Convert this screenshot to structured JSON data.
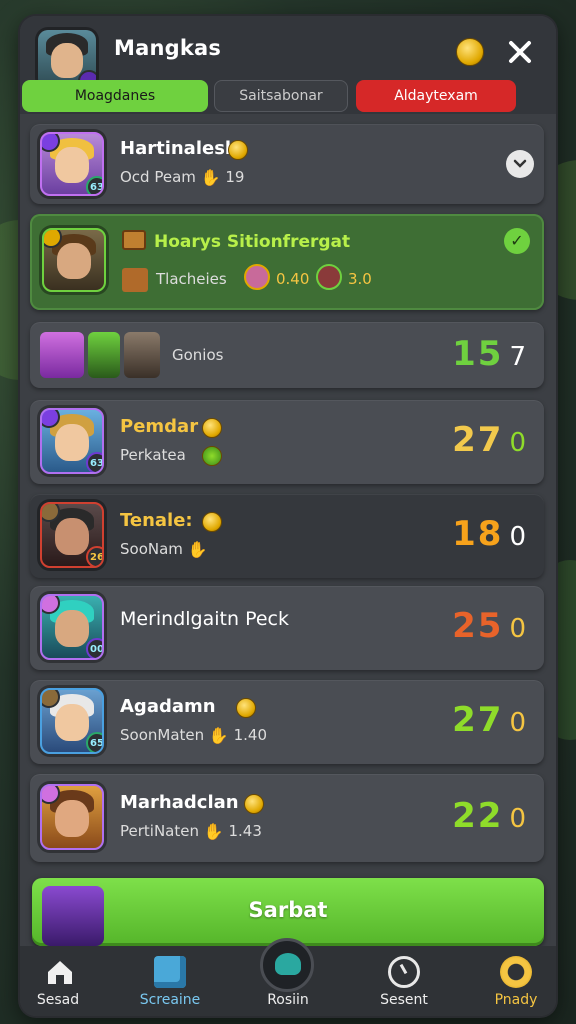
{
  "header": {
    "title": "Mangkas",
    "tabs": [
      {
        "label": "Moagdanes",
        "color": "#6fd13f"
      },
      {
        "label": "Saitsabonar",
        "color": "#3a3d42"
      },
      {
        "label": "Aldaytexam",
        "color": "#d62828"
      }
    ]
  },
  "featured": {
    "name": "Hartinalesk",
    "sub": "Ocd Peam",
    "count": "19",
    "badge": "63"
  },
  "highlight": {
    "title": "Hoarys Sitionfrergat",
    "sub": "Tlacheies",
    "stat1": "0.40",
    "stat2": "3.0"
  },
  "group_row": {
    "label": "Gonios",
    "score_main": "15",
    "score_tail": "7"
  },
  "players": [
    {
      "name": "Pemdar",
      "sub": "Perkatea",
      "stat": "",
      "badge": "63",
      "score_main": "27",
      "score_tail": "0",
      "name_color": "#f5c542",
      "score_color": "#f2c94c"
    },
    {
      "name": "Tenale:",
      "sub": "SooNam",
      "stat": "",
      "badge": "26",
      "score_main": "18",
      "score_tail": "0",
      "name_color": "#f5c542",
      "score_color": "#f7a21b"
    },
    {
      "name": "Merindlgaitn Peck",
      "sub": "",
      "stat": "",
      "badge": "00",
      "score_main": "25",
      "score_tail": "0",
      "name_color": "#ffffff",
      "score_color": "#e8632a"
    },
    {
      "name": "Agadamn",
      "sub": "SoonMaten",
      "stat": "1.40",
      "badge": "65",
      "score_main": "27",
      "score_tail": "0",
      "name_color": "#ffffff",
      "score_color": "#8fdc2a"
    },
    {
      "name": "Marhadclan",
      "sub": "PertiNaten",
      "stat": "1.43",
      "badge": "",
      "score_main": "22",
      "score_tail": "0",
      "name_color": "#ffffff",
      "score_color": "#8fdc2a"
    }
  ],
  "start_button": {
    "label": "Sarbat"
  },
  "nav": [
    {
      "label": "Sesad",
      "icon": "home-icon"
    },
    {
      "label": "Screaine",
      "icon": "cube-icon"
    },
    {
      "label": "Rosiin",
      "icon": "dragon-icon"
    },
    {
      "label": "Sesent",
      "icon": "clock-icon"
    },
    {
      "label": "Pnady",
      "icon": "coin-icon"
    }
  ]
}
